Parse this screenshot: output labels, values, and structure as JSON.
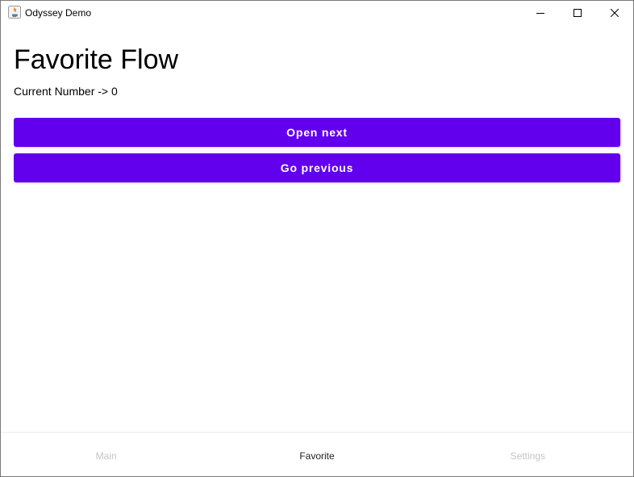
{
  "window": {
    "title": "Odyssey Demo",
    "icon": "java-app-icon",
    "controls": {
      "minimize": "minimize-icon",
      "maximize": "maximize-icon",
      "close": "close-icon"
    }
  },
  "page": {
    "title": "Favorite Flow",
    "counter_text": "Current Number -> 0"
  },
  "buttons": {
    "next_label": "Open next",
    "previous_label": "Go previous"
  },
  "bottom_nav": {
    "items": [
      {
        "label": "Main",
        "active": false
      },
      {
        "label": "Favorite",
        "active": true
      },
      {
        "label": "Settings",
        "active": false
      }
    ]
  },
  "colors": {
    "accent": "#6200ee",
    "nav_active": "#222222",
    "nav_inactive": "#c4c4c4"
  }
}
